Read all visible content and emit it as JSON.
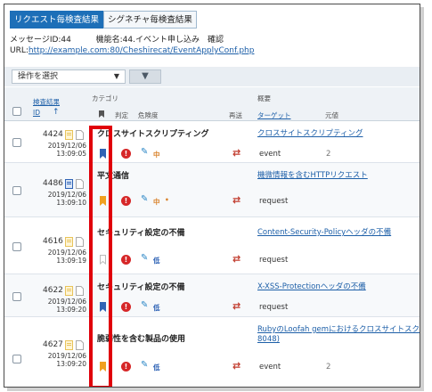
{
  "tabs": [
    "リクエスト毎検査結果",
    "シグネチャ毎検査結果"
  ],
  "meta": {
    "message_id": "メッセージID:44",
    "function_name": "機能名:44.イベント申し込み　確認",
    "url_label": "URL:",
    "url": "http://example.com:80/Cheshirecat/EventApplyConf.php"
  },
  "toolbar": {
    "select_value": "操作を選択",
    "select_arrow": "▼",
    "filter_icon": "▼"
  },
  "header": {
    "inspection_result": "検査結果",
    "id": "ID",
    "sort_icon": "↑",
    "category": "カテゴリ",
    "judge": "判定",
    "severity": "危険度",
    "resend": "再送",
    "overview": "概要",
    "target": "ターゲット",
    "source": "元値"
  },
  "rows": [
    {
      "id": "4424",
      "date": "2019/12/06",
      "time": "13:09:05",
      "title": "クロスサイトスクリプティング",
      "overview": "クロスサイトスクリプティング",
      "flag_color": "#2f63b5",
      "flag_filled": true,
      "severity": "中",
      "severity_color": "#d9822b",
      "extra_dot": false,
      "target": "event",
      "source": "2",
      "doc_color": "#e8c35a"
    },
    {
      "id": "4486",
      "date": "2019/12/06",
      "time": "13:09:10",
      "title": "平文通信",
      "overview": "機微情報を含むHTTPリクエスト",
      "flag_color": "#f0a020",
      "flag_filled": true,
      "severity": "中",
      "severity_color": "#d9822b",
      "extra_dot": true,
      "target": "request",
      "source": "",
      "doc_color": "#2f63b5"
    },
    {
      "id": "4616",
      "date": "2019/12/06",
      "time": "13:09:19",
      "title": "セキュリティ設定の不備",
      "overview": "Content-Security-Policyヘッダの不備",
      "flag_color": "#bbbbbb",
      "flag_filled": false,
      "severity": "低",
      "severity_color": "#2f63b5",
      "extra_dot": false,
      "target": "request",
      "source": "",
      "doc_color": "#e8c35a"
    },
    {
      "id": "4622",
      "date": "2019/12/06",
      "time": "13:09:20",
      "title": "セキュリティ設定の不備",
      "overview": "X-XSS-Protectionヘッダの不備",
      "flag_color": "#2f63b5",
      "flag_filled": true,
      "severity": "低",
      "severity_color": "#2f63b5",
      "extra_dot": false,
      "target": "request",
      "source": "",
      "doc_color": "#e8c35a"
    },
    {
      "id": "4627",
      "date": "2019/12/06",
      "time": "13:09:20",
      "title": "脆弱性を含む製品の使用",
      "overview": "RubyのLoofah gemにおけるクロスサイトスクリ",
      "overview2": "8048)",
      "flag_color": "#f0a020",
      "flag_filled": true,
      "severity": "低",
      "severity_color": "#2f63b5",
      "extra_dot": false,
      "target": "event",
      "source": "2",
      "doc_color": "#e8c35a"
    }
  ]
}
